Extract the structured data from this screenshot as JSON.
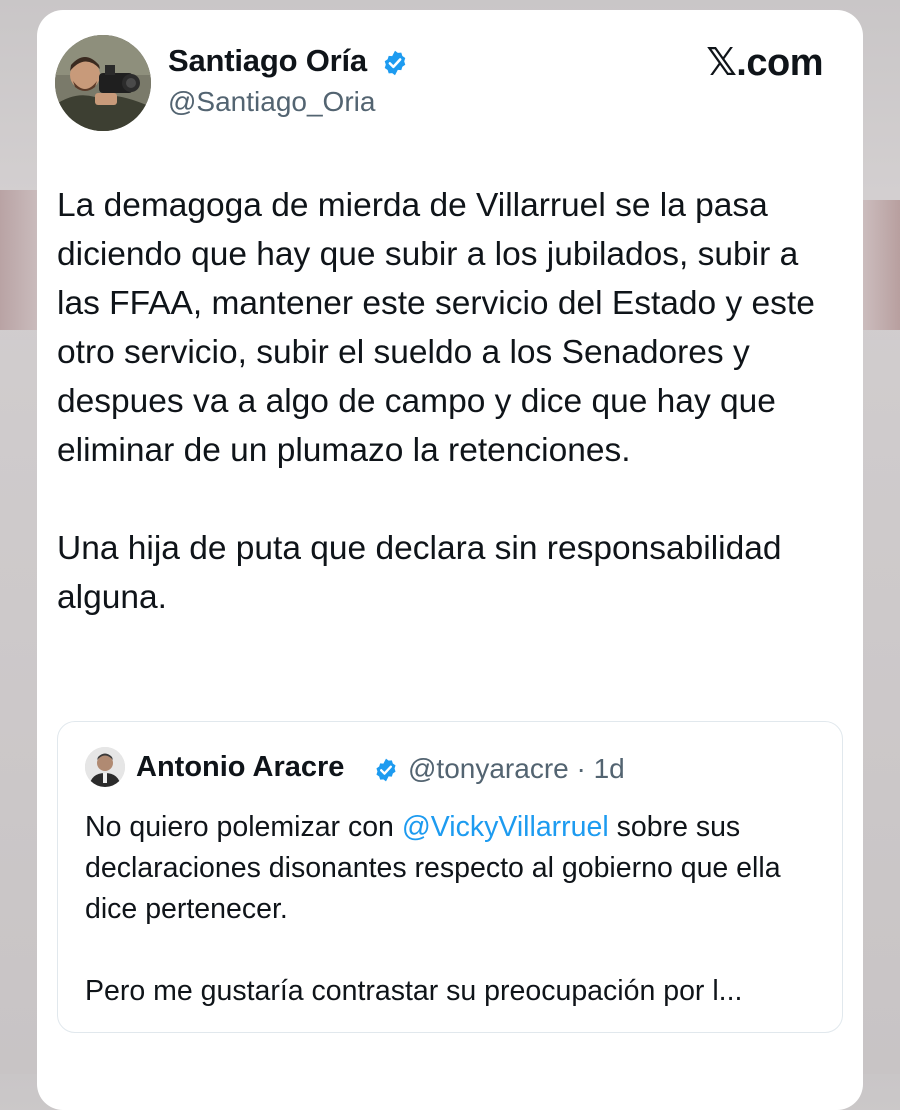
{
  "brand": "𝕏.com",
  "colors": {
    "verified": "#1d9bf0",
    "link": "#1d9bf0",
    "text": "#0f1419",
    "secondary": "#536471"
  },
  "tweet": {
    "author_name": "Santiago Oría",
    "handle": "@Santiago_Oria",
    "verified_icon": "verified-badge-icon",
    "paragraph_1": "La demagoga de mierda de Villarruel se la pasa diciendo que hay que subir a los jubilados, subir a las FFAA, mantener este servicio del Estado y este otro servicio, subir el sueldo a los Senadores y despues va a algo de campo y dice que hay que eliminar de un plumazo la retenciones.",
    "paragraph_2": "Una hija de puta que declara sin responsabilidad alguna."
  },
  "quoted_tweet": {
    "author_name": "Antonio Aracre",
    "handle_time": "@tonyaracre · 1d",
    "verified_icon": "verified-badge-icon",
    "p1_before": "No quiero polemizar con ",
    "p1_mention": "@VickyVillarruel",
    "p1_after": " sobre sus declaraciones disonantes respecto al gobierno que ella dice pertenecer.",
    "paragraph_2": "Pero me gustaría contrastar su preocupación por l..."
  }
}
